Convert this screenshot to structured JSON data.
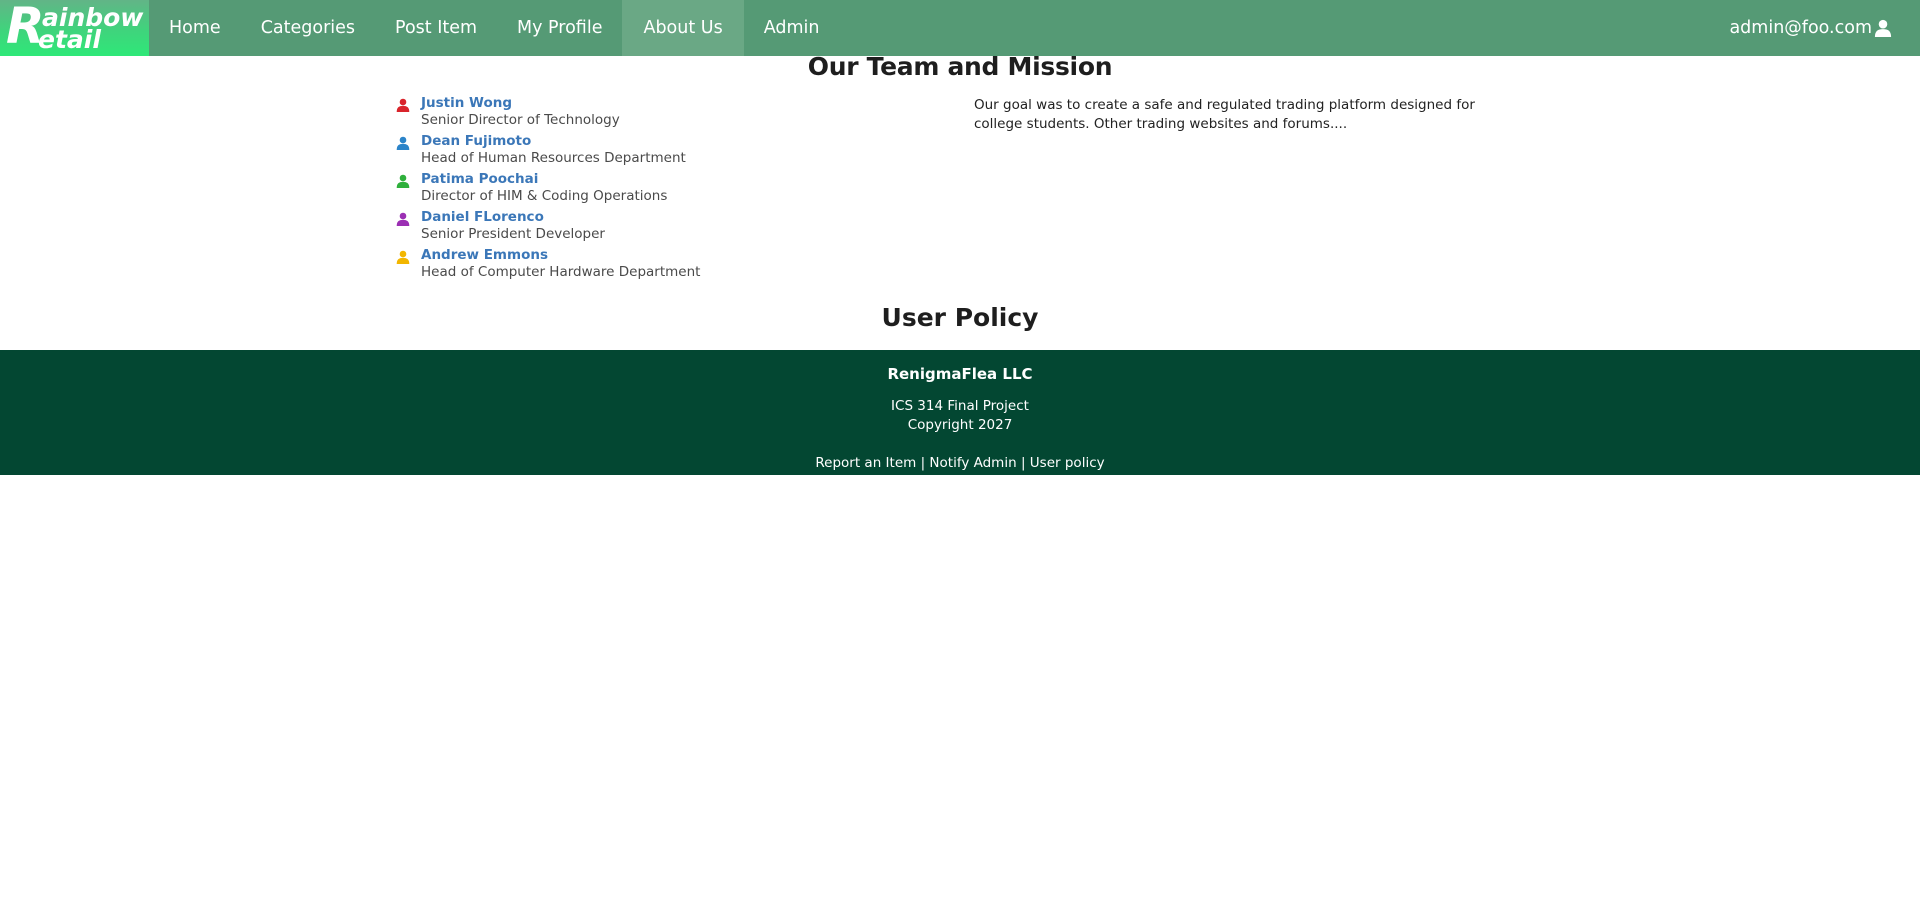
{
  "brand": {
    "logo_initial": "R",
    "logo_line1": "ainbow",
    "logo_line2": "etail"
  },
  "nav": {
    "items": [
      {
        "label": "Home"
      },
      {
        "label": "Categories"
      },
      {
        "label": "Post Item"
      },
      {
        "label": "My Profile"
      },
      {
        "label": "About Us",
        "active": true
      },
      {
        "label": "Admin"
      }
    ],
    "user_email": "admin@foo.com",
    "user_icon": "user-icon",
    "bar_color": "#559a75",
    "active_color": "#6aa885"
  },
  "main": {
    "title": "Our Team and Mission",
    "team": [
      {
        "name": "Justin Wong",
        "role": "Senior Director of Technology",
        "icon": "user-icon",
        "icon_color": "#d9242b"
      },
      {
        "name": "Dean Fujimoto",
        "role": "Head of Human Resources Department",
        "icon": "user-icon",
        "icon_color": "#2b84c9"
      },
      {
        "name": "Patima Poochai",
        "role": "Director of HIM & Coding Operations",
        "icon": "user-icon",
        "icon_color": "#2fb03c"
      },
      {
        "name": "Daniel FLorenco",
        "role": "Senior President Developer",
        "icon": "user-icon",
        "icon_color": "#9b2fb3"
      },
      {
        "name": "Andrew Emmons",
        "role": "Head of Computer Hardware Department",
        "icon": "user-icon",
        "icon_color": "#f2b600"
      }
    ],
    "mission_text": "Our goal was to create a safe and regulated trading platform designed for college students. Other trading websites and forums....",
    "policy_title": "User Policy"
  },
  "footer": {
    "company": "RenigmaFlea LLC",
    "project": "ICS 314 Final Project",
    "copyright": "Copyright 2027",
    "links": [
      {
        "label": "Report an Item"
      },
      {
        "label": "Notify Admin"
      },
      {
        "label": "User policy"
      }
    ],
    "separator": " | ",
    "background": "#034732"
  }
}
